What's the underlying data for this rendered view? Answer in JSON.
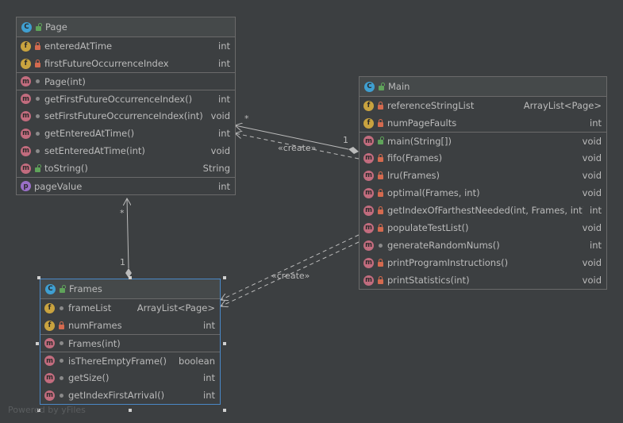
{
  "classes": {
    "page": {
      "name": "Page",
      "fields": [
        {
          "name": "enteredAtTime",
          "type": "int"
        },
        {
          "name": "firstFutureOccurrenceIndex",
          "type": "int"
        }
      ],
      "constructors": [
        {
          "name": "Page(int)",
          "type": ""
        }
      ],
      "methods": [
        {
          "name": "getFirstFutureOccurrenceIndex()",
          "type": "int"
        },
        {
          "name": "setFirstFutureOccurrenceIndex(int)",
          "type": "void"
        },
        {
          "name": "getEnteredAtTime()",
          "type": "int"
        },
        {
          "name": "setEnteredAtTime(int)",
          "type": "void"
        },
        {
          "name": "toString()",
          "type": "String"
        }
      ],
      "properties": [
        {
          "name": "pageValue",
          "type": "int"
        }
      ]
    },
    "main": {
      "name": "Main",
      "fields": [
        {
          "name": "referenceStringList",
          "type": "ArrayList<Page>"
        },
        {
          "name": "numPageFaults",
          "type": "int"
        }
      ],
      "methods": [
        {
          "name": "main(String[])",
          "type": "void"
        },
        {
          "name": "fifo(Frames)",
          "type": "void"
        },
        {
          "name": "lru(Frames)",
          "type": "void"
        },
        {
          "name": "optimal(Frames, int)",
          "type": "void"
        },
        {
          "name": "getIndexOfFarthestNeeded(int, Frames, int)",
          "type": "int"
        },
        {
          "name": "populateTestList()",
          "type": "void"
        },
        {
          "name": "generateRandomNums()",
          "type": "int"
        },
        {
          "name": "printProgramInstructions()",
          "type": "void"
        },
        {
          "name": "printStatistics(int)",
          "type": "void"
        }
      ]
    },
    "frames": {
      "name": "Frames",
      "fields": [
        {
          "name": "frameList",
          "type": "ArrayList<Page>"
        },
        {
          "name": "numFrames",
          "type": "int"
        }
      ],
      "constructors": [
        {
          "name": "Frames(int)",
          "type": ""
        }
      ],
      "methods": [
        {
          "name": "isThereEmptyFrame()",
          "type": "boolean"
        },
        {
          "name": "getSize()",
          "type": "int"
        },
        {
          "name": "getIndexFirstArrival()",
          "type": "int"
        }
      ]
    }
  },
  "edges": {
    "main_page_star": "*",
    "main_page_one": "1",
    "main_page_create": "«create»",
    "frames_page_star": "*",
    "frames_page_one": "1",
    "main_frames_create": "«create»"
  },
  "watermark": "Powered by yFiles",
  "icons": {
    "class": "C",
    "field": "f",
    "method": "m",
    "property": "p"
  }
}
